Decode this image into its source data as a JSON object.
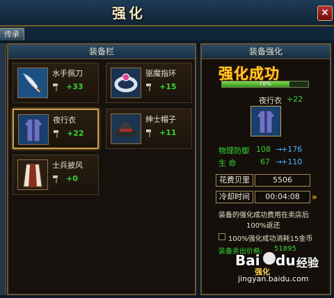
{
  "window": {
    "title": "强化",
    "close": "×"
  },
  "tabs": [
    {
      "label": "传承"
    }
  ],
  "left_panel": {
    "title": "装备栏",
    "items": [
      {
        "name": "水手佩刀",
        "value": "+33",
        "icon": "saber-icon",
        "selected": false
      },
      {
        "name": "驱魔指环",
        "value": "+15",
        "icon": "ring-icon",
        "selected": false
      },
      {
        "name": "夜行衣",
        "value": "+22",
        "icon": "robe-icon",
        "selected": true
      },
      {
        "name": "绅士帽子",
        "value": "+11",
        "icon": "hat-icon",
        "selected": false
      },
      {
        "name": "士兵披风",
        "value": "+0",
        "icon": "cloak-icon",
        "selected": false
      }
    ]
  },
  "right_panel": {
    "title": "装备强化",
    "result_text": "强化成功",
    "progress": {
      "value": 0.78,
      "label": "78%"
    },
    "item_name": "夜行衣",
    "item_value": "+22",
    "stats": [
      {
        "label": "物理防御",
        "current": "108",
        "next": "+176"
      },
      {
        "label": "生  命",
        "current": "67",
        "next": "+110"
      }
    ],
    "cost_label": "花费贝里",
    "cost_value": "5506",
    "cooldown_label": "冷却时间",
    "cooldown_value": "00:04:08",
    "note": "装备的强化成功费用在卖店后",
    "note2": "100%返还",
    "checkbox_label": "100%强化成功消耗15金币",
    "sell_price_label": "装备卖出价格:",
    "sell_price_value": "51895",
    "button_label": "强化"
  },
  "watermark": {
    "brand": "Bai",
    "brand2": "du",
    "cn": "经验",
    "url": "jingyan.baidu.com"
  },
  "colors": {
    "gold": "#ffcf25",
    "green": "#36d435",
    "cyan": "#46b9ff",
    "frame": "#6e5431"
  }
}
